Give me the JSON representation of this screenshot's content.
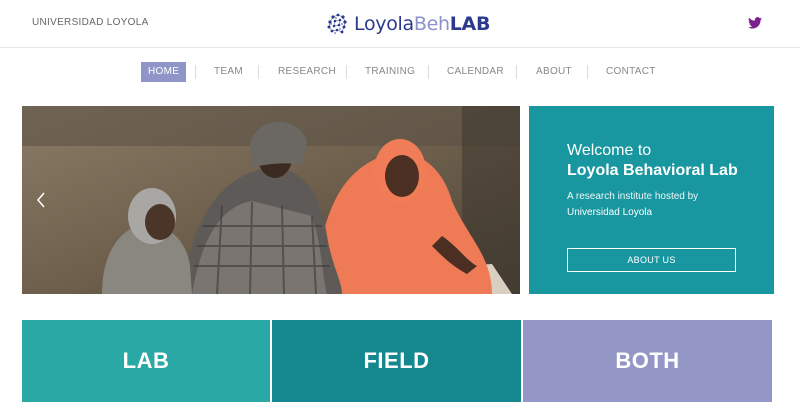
{
  "header": {
    "university_link": "UNIVERSIDAD LOYOLA",
    "logo": {
      "part1": "Loyola",
      "part2": "Beh",
      "part3": "LAB",
      "icon": "brain-network-icon"
    },
    "social_icon": "twitter-icon"
  },
  "nav": {
    "items": [
      {
        "label": "HOME",
        "active": true
      },
      {
        "label": "TEAM",
        "active": false
      },
      {
        "label": "RESEARCH",
        "active": false
      },
      {
        "label": "TRAINING",
        "active": false
      },
      {
        "label": "CALENDAR",
        "active": false
      },
      {
        "label": "ABOUT",
        "active": false
      },
      {
        "label": "CONTACT",
        "active": false
      }
    ]
  },
  "hero": {
    "image": "photo of women and child reviewing documents",
    "prev_icon": "chevron-left-icon"
  },
  "welcome": {
    "line1": "Welcome to",
    "line2": "Loyola Behavioral Lab",
    "line3": "A research institute hosted by",
    "line4": "Universidad Loyola",
    "button": "ABOUT US"
  },
  "tiles": [
    {
      "label": "LAB"
    },
    {
      "label": "FIELD"
    },
    {
      "label": "BOTH"
    }
  ],
  "colors": {
    "brand_navy": "#2b3a8c",
    "brand_lavender": "#8f95c7",
    "teal": "#1997a0",
    "tile_lab": "#2aa8a6",
    "tile_field": "#15878f",
    "tile_both": "#9497c6",
    "twitter": "#7b1f8c"
  }
}
